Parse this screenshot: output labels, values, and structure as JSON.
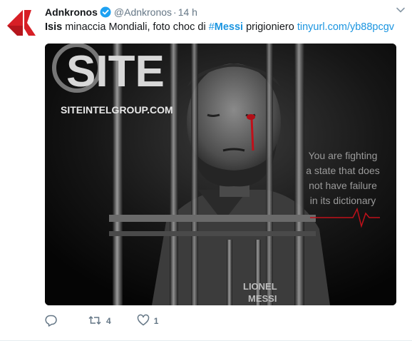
{
  "tweet": {
    "author_name": "Adnkronos",
    "author_handle": "@Adnkronos",
    "separator": "·",
    "timestamp": "14 h",
    "text_bold": "Isis",
    "text_part1": " minaccia Mondiali, foto choc di ",
    "hashtag_symbol": "#",
    "hashtag_word": "Messi",
    "text_part2": " prigioniero ",
    "link": "tinyurl.com/yb88pcgv"
  },
  "media": {
    "logo_text": "SITE",
    "site_url": "SITEINTELGROUP.COM",
    "quote_lines": [
      "You are fighting",
      "a state that does",
      "not have failure",
      "in its dictionary"
    ],
    "shirt_lines": [
      "LIONEL",
      "MESSI"
    ]
  },
  "actions": {
    "reply_count": "",
    "retweet_count": "4",
    "like_count": "1"
  },
  "icons": {
    "avatar": "adnkronos-logo-icon",
    "verified": "verified-badge-icon",
    "caret": "chevron-down-icon",
    "reply": "reply-icon",
    "retweet": "retweet-icon",
    "like": "heart-icon"
  },
  "colors": {
    "brand_red": "#d71f26",
    "link_blue": "#1b95e0",
    "verified_blue": "#1da1f2",
    "muted": "#657786"
  }
}
